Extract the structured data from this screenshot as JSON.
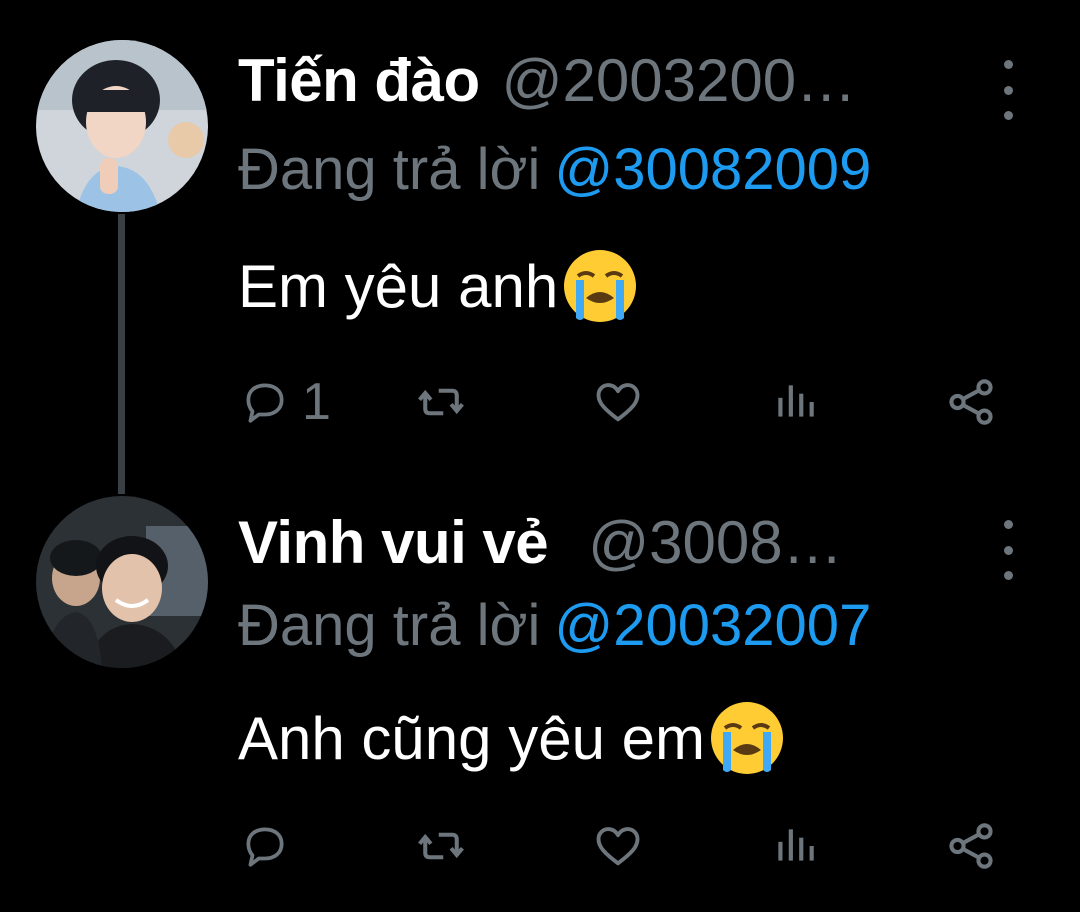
{
  "tweets": [
    {
      "name": "Tiến đào",
      "handle": "@2003200…",
      "reply_prefix": "Đang trả lời",
      "reply_to": "@30082009",
      "text": "Em yêu anh",
      "emoji": "loudly-crying-face",
      "reply_count": "1"
    },
    {
      "name": "Vinh vui vẻ",
      "handle": "@3008…",
      "reply_prefix": "Đang trả lời",
      "reply_to": "@20032007",
      "text": "Anh cũng yêu em",
      "emoji": "loudly-crying-face",
      "reply_count": ""
    }
  ],
  "colors": {
    "background": "#000000",
    "text": "#ffffff",
    "muted": "#6e767d",
    "link": "#1d9bf0",
    "thread_line": "#3a3f44"
  },
  "icons": [
    "reply-icon",
    "retweet-icon",
    "like-icon",
    "views-icon",
    "share-icon",
    "more-icon"
  ]
}
